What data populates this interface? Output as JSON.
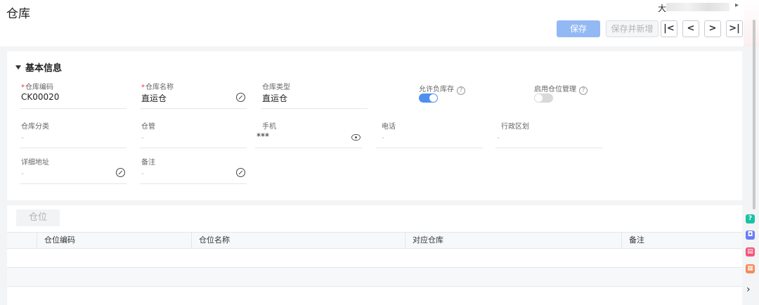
{
  "page": {
    "title": "仓库"
  },
  "user": {
    "name": "大",
    "menu_arrow": "▸"
  },
  "toolbar": {
    "save_label": "保存",
    "save_new_label": "保存并新增",
    "nav_first": "|<",
    "nav_prev": "<",
    "nav_next": ">",
    "nav_last": ">|"
  },
  "basic": {
    "section_title": "基本信息",
    "required_mark": "*",
    "fields": {
      "code": {
        "label": "仓库编码",
        "value": "CK00020"
      },
      "name": {
        "label": "仓库名称",
        "value": "直运仓"
      },
      "type": {
        "label": "仓库类型",
        "value": "直运仓"
      },
      "negative_stock": {
        "label": "允许负库存",
        "help": "?",
        "enabled": true
      },
      "location_mgmt": {
        "label": "启用仓位管理",
        "help": "?",
        "enabled": false
      },
      "category": {
        "label": "仓库分类",
        "placeholder": "-"
      },
      "keeper": {
        "label": "仓管",
        "placeholder": "-"
      },
      "mobile": {
        "label": "手机",
        "value": "***"
      },
      "phone": {
        "label": "电话",
        "placeholder": "-"
      },
      "region": {
        "label": "行政区划",
        "placeholder": "-"
      },
      "address": {
        "label": "详细地址",
        "placeholder": "-"
      },
      "remark": {
        "label": "备注",
        "placeholder": "-"
      }
    }
  },
  "locations": {
    "tab_label": "仓位",
    "columns": [
      "仓位编码",
      "仓位名称",
      "对应仓库",
      "备注"
    ],
    "rows": []
  },
  "sidebar_icons": [
    {
      "name": "help-icon",
      "glyph": "?",
      "color": "#19c2a6"
    },
    {
      "name": "chat-icon",
      "glyph": "◘",
      "color": "#6a7cf6"
    },
    {
      "name": "note-icon",
      "glyph": "▤",
      "color": "#f2567a"
    },
    {
      "name": "gift-icon",
      "glyph": "▦",
      "color": "#f58a5a"
    }
  ],
  "colors": {
    "primary": "#4f8ff0",
    "primary_light": "#93b9f4",
    "required": "#e33333"
  }
}
